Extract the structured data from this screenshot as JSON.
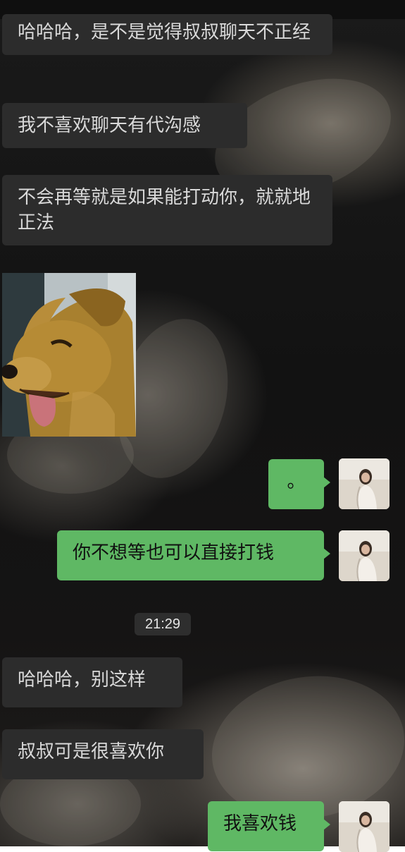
{
  "chat": {
    "messages": [
      {
        "sender": "other",
        "text": "哈哈哈，是不是觉得叔叔聊天不正经"
      },
      {
        "sender": "other",
        "text": "我不喜欢聊天有代沟感"
      },
      {
        "sender": "other",
        "text": "不会再等就是如果能打动你，就就地正法"
      },
      {
        "sender": "other",
        "type": "sticker",
        "icon": "dog-sticker"
      },
      {
        "sender": "me",
        "text": "。"
      },
      {
        "sender": "me",
        "text": "你不想等也可以直接打钱"
      },
      {
        "sender": "other",
        "text": "哈哈哈，别这样"
      },
      {
        "sender": "other",
        "text": "叔叔可是很喜欢你"
      },
      {
        "sender": "me",
        "text": "我喜欢钱"
      }
    ],
    "timestamp": "21:29"
  },
  "colors": {
    "incoming_bubble": "#2c2c2c",
    "outgoing_bubble": "#5fb864"
  }
}
